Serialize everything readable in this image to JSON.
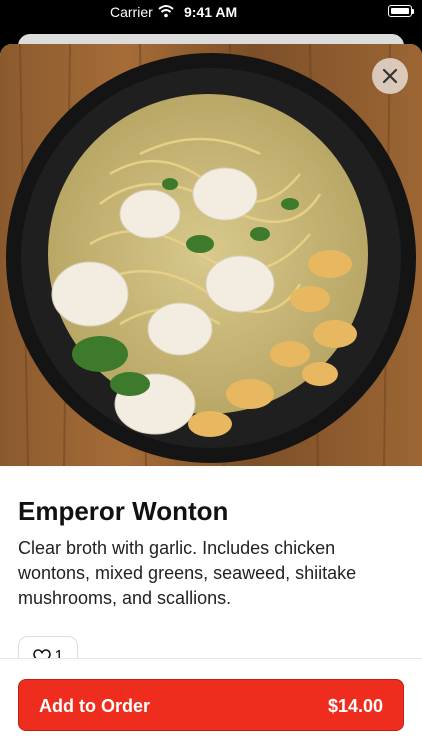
{
  "status_bar": {
    "carrier": "Carrier",
    "time": "9:41 AM"
  },
  "item": {
    "name": "Emperor Wonton",
    "description": "Clear broth with garlic. Includes chicken wontons, mixed greens, seaweed, shiitake mushrooms, and scallions.",
    "like_count": "1"
  },
  "footer": {
    "add_label": "Add to Order",
    "price": "$14.00"
  },
  "colors": {
    "accent": "#ef2d1e"
  }
}
